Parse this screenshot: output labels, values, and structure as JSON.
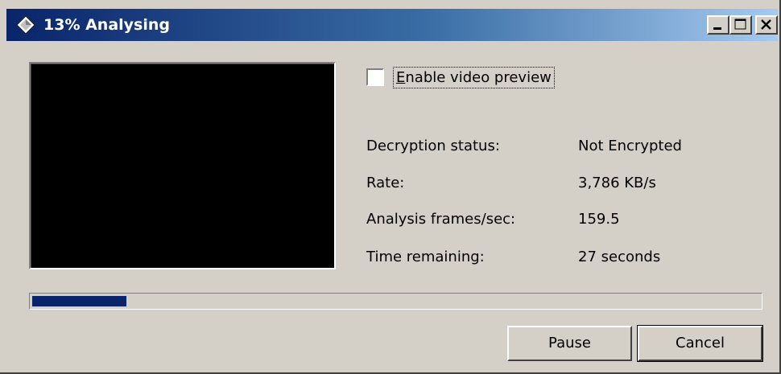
{
  "window": {
    "title": "13% Analysing",
    "controls": [
      "minimize-icon",
      "maximize-icon",
      "close-icon"
    ],
    "title_gradient": [
      "#0a246a",
      "#a6caf0"
    ]
  },
  "preview": {
    "background": "#000000"
  },
  "options": {
    "enable_preview": {
      "mnemonic": "E",
      "label_rest": "nable video preview",
      "checked": false
    }
  },
  "info": {
    "decryption_status_label": "Decryption status:",
    "decryption_status_value": "Not Encrypted",
    "rate_label": "Rate:",
    "rate_value": "3,786 KB/s",
    "fps_label": "Analysis frames/sec:",
    "fps_value": "159.5",
    "time_label": "Time remaining:",
    "time_value": "27 seconds"
  },
  "progress": {
    "percent": 13,
    "color": "#0a246a"
  },
  "buttons": {
    "pause": "Pause",
    "cancel": "Cancel"
  }
}
